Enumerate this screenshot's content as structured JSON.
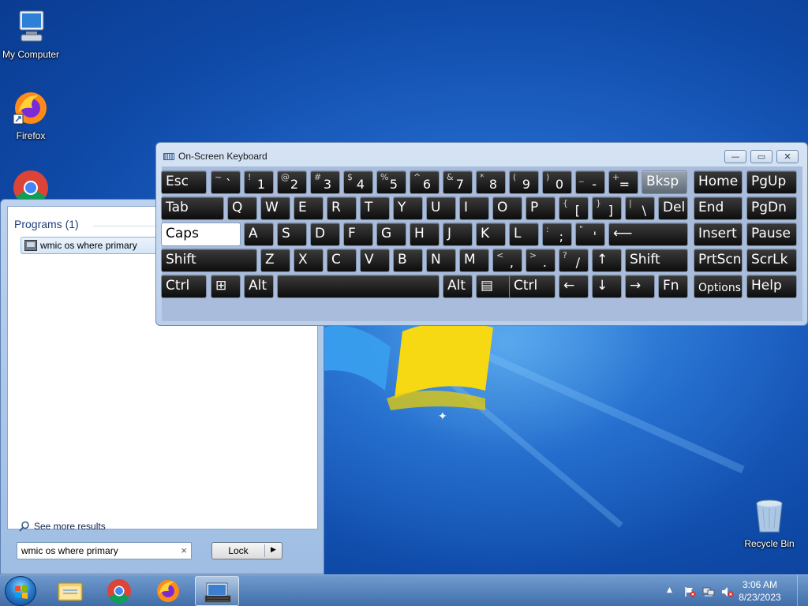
{
  "desktop": {
    "icons": [
      {
        "label": "My Computer"
      },
      {
        "label": "Firefox"
      },
      {
        "label": "Recycle Bin"
      }
    ]
  },
  "start_menu": {
    "programs_header": "Programs (1)",
    "program_item": "wmic os where primary",
    "see_more": "See more results",
    "search_value": "wmic os where primary",
    "search_clear": "×",
    "power_button": "Lock",
    "power_arrow": "▶"
  },
  "osk": {
    "title": "On-Screen Keyboard",
    "window_buttons": {
      "minimize": "—",
      "restore": "▭",
      "close": "✕"
    },
    "rows": [
      [
        {
          "l": "Esc"
        },
        {
          "t": "~",
          "b": "`"
        },
        {
          "t": "!",
          "b": "1"
        },
        {
          "t": "@",
          "b": "2"
        },
        {
          "t": "#",
          "b": "3"
        },
        {
          "t": "$",
          "b": "4"
        },
        {
          "t": "%",
          "b": "5"
        },
        {
          "t": "^",
          "b": "6"
        },
        {
          "t": "&",
          "b": "7"
        },
        {
          "t": "*",
          "b": "8"
        },
        {
          "t": "(",
          "b": "9"
        },
        {
          "t": ")",
          "b": "0"
        },
        {
          "t": "_",
          "b": "-"
        },
        {
          "t": "+",
          "b": "="
        },
        {
          "l": "Bksp"
        },
        {
          "l": "Home"
        },
        {
          "l": "PgUp"
        }
      ],
      [
        {
          "l": "Tab"
        },
        {
          "l": "Q"
        },
        {
          "l": "W"
        },
        {
          "l": "E"
        },
        {
          "l": "R"
        },
        {
          "l": "T"
        },
        {
          "l": "Y"
        },
        {
          "l": "U"
        },
        {
          "l": "I"
        },
        {
          "l": "O"
        },
        {
          "l": "P"
        },
        {
          "t": "{",
          "b": "["
        },
        {
          "t": "}",
          "b": "]"
        },
        {
          "t": "|",
          "b": "\\"
        },
        {
          "l": "Del"
        },
        {
          "l": "End"
        },
        {
          "l": "PgDn"
        }
      ],
      [
        {
          "l": "Caps"
        },
        {
          "l": "A"
        },
        {
          "l": "S"
        },
        {
          "l": "D"
        },
        {
          "l": "F"
        },
        {
          "l": "G"
        },
        {
          "l": "H"
        },
        {
          "l": "J"
        },
        {
          "l": "K"
        },
        {
          "l": "L"
        },
        {
          "t": ":",
          "b": ";"
        },
        {
          "t": "\"",
          "b": "'"
        },
        {
          "l": "⟵"
        },
        {
          "l": "Insert"
        },
        {
          "l": "Pause"
        }
      ],
      [
        {
          "l": "Shift"
        },
        {
          "l": "Z"
        },
        {
          "l": "X"
        },
        {
          "l": "C"
        },
        {
          "l": "V"
        },
        {
          "l": "B"
        },
        {
          "l": "N"
        },
        {
          "l": "M"
        },
        {
          "t": "<",
          "b": ","
        },
        {
          "t": ">",
          "b": "."
        },
        {
          "t": "?",
          "b": "/"
        },
        {
          "l": "↑"
        },
        {
          "l": "Shift"
        },
        {
          "l": "PrtScn"
        },
        {
          "l": "ScrLk"
        }
      ],
      [
        {
          "l": "Ctrl"
        },
        {
          "l": "⊞"
        },
        {
          "l": "Alt"
        },
        {
          "l": ""
        },
        {
          "l": "Alt"
        },
        {
          "l": "▤"
        },
        {
          "l": "Ctrl"
        },
        {
          "l": "←"
        },
        {
          "l": "↓"
        },
        {
          "l": "→"
        },
        {
          "l": "Fn"
        },
        {
          "l": "Options"
        },
        {
          "l": "Help"
        }
      ]
    ]
  },
  "taskbar": {
    "time": "3:06 AM",
    "date": "8/23/2023",
    "tray_arrow": "▲"
  }
}
